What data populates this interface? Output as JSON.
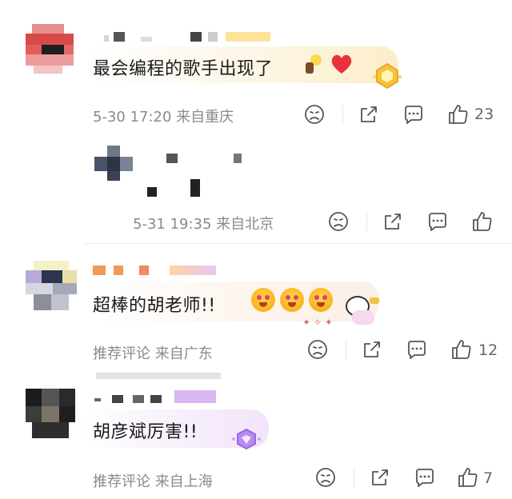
{
  "comments": [
    {
      "text": "最会编程的歌手出现了",
      "meta": "5-30 17:20 来自重庆",
      "likes": "23"
    },
    {
      "meta": "5-31 19:35 来自北京",
      "likes": ""
    },
    {
      "text": "超棒的胡老师!!",
      "meta": "推荐评论 来自广东",
      "likes": "12"
    },
    {
      "text": "胡彦斌厉害!!",
      "meta": "推荐评论 来自上海",
      "likes": "7"
    }
  ],
  "icons": {
    "sad": "sad-face-icon",
    "share": "share-icon",
    "reply": "comment-bubble-icon",
    "like": "thumbs-up-icon"
  },
  "colors": {
    "meta_text": "#8a8a8a",
    "bubble_gold": "#fdf3dc",
    "bubble_purple": "#f6edfb",
    "heart": "#e8323c"
  }
}
